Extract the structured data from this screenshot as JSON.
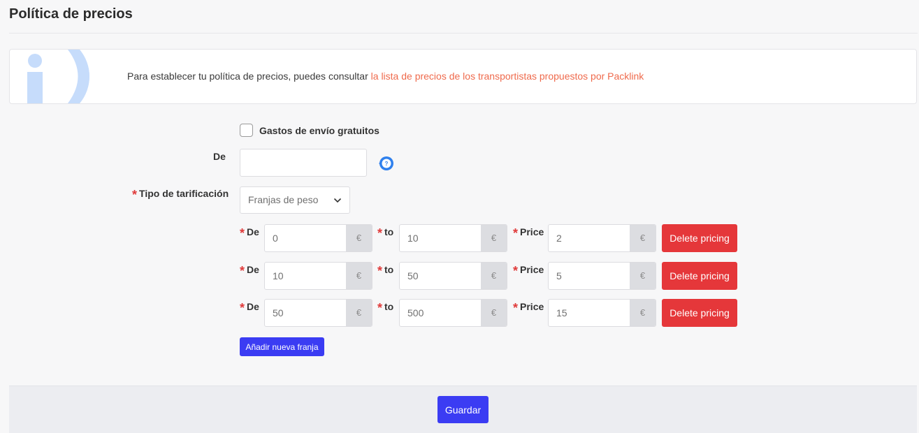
{
  "page": {
    "title": "Política de precios"
  },
  "info": {
    "icon": "info-icon",
    "text": "Para establecer tu política de precios, puedes consultar ",
    "link_text": "la lista de precios de los transportistas propuestos por Packlink",
    "link_color": "#ef6a4c"
  },
  "form": {
    "free_shipping_label": "Gastos de envío gratuitos",
    "free_shipping_checked": false,
    "from_label": "De",
    "from_value": "",
    "help_icon": "question-icon",
    "pricing_type_label": "Tipo de tarificación",
    "pricing_type_value": "Franjas de peso",
    "required_mark": "*",
    "currency_symbol": "€",
    "range_labels": {
      "from": "De",
      "to": "to",
      "price": "Price"
    },
    "ranges": [
      {
        "from": "0",
        "to": "10",
        "price": "2"
      },
      {
        "from": "10",
        "to": "50",
        "price": "5"
      },
      {
        "from": "50",
        "to": "500",
        "price": "15"
      }
    ],
    "delete_label": "Delete pricing",
    "add_label": "Añadir nueva franja"
  },
  "footer": {
    "save_label": "Guardar"
  },
  "colors": {
    "primary": "#3b3cf3",
    "danger": "#e5373a",
    "required": "#e03a3a",
    "info_icon": "#c6dcfb",
    "help_icon": "#2f80ed"
  }
}
